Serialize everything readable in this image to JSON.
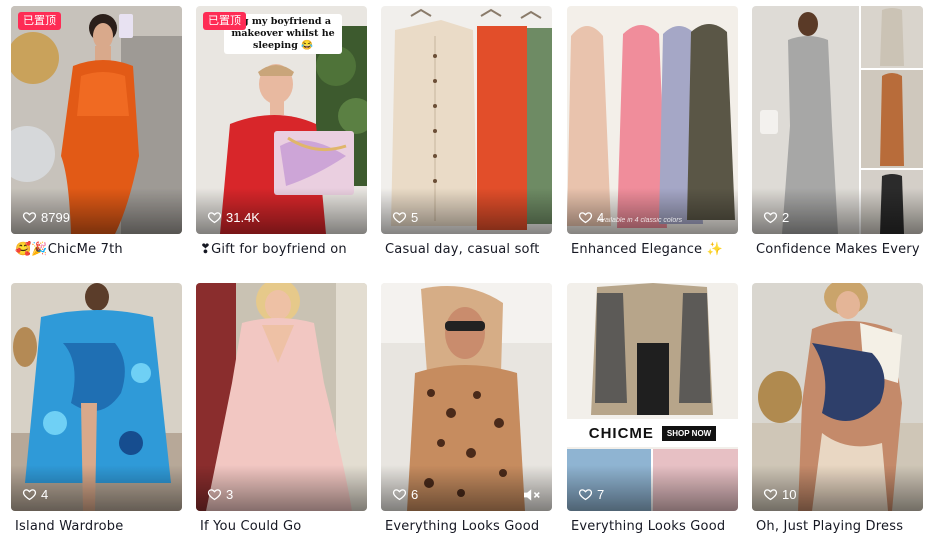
{
  "icons": {
    "like": "heart-outline-icon",
    "mute": "speaker-muted-icon"
  },
  "colors": {
    "pin_badge": "#fe2c55",
    "caption_text": "#161823"
  },
  "videos": [
    {
      "likes": "8799",
      "caption": "🥰🎉ChicMe 7th",
      "pinned": true,
      "pin_label": "已置顶",
      "overlay": ""
    },
    {
      "likes": "31.4K",
      "caption": "❣Gift for boyfriend on",
      "pinned": true,
      "pin_label": "已置顶",
      "overlay": "ng my boyfriend a makeover whilst he sleeping 😂"
    },
    {
      "likes": "5",
      "caption": "Casual day, casual soft",
      "pinned": false,
      "overlay": ""
    },
    {
      "likes": "4",
      "caption": "Enhanced Elegance ✨",
      "pinned": false,
      "overlay": "Available in 4 classic colors"
    },
    {
      "likes": "2",
      "caption": "Confidence Makes Every",
      "pinned": false,
      "overlay": ""
    },
    {
      "likes": "4",
      "caption": "Island Wardrobe",
      "pinned": false,
      "overlay": ""
    },
    {
      "likes": "3",
      "caption": "If You Could Go",
      "pinned": false,
      "overlay": ""
    },
    {
      "likes": "6",
      "caption": "Everything Looks Good",
      "pinned": false,
      "overlay": "",
      "muted": true
    },
    {
      "likes": "7",
      "caption": "Everything Looks Good",
      "pinned": false,
      "overlay": "",
      "brand": "CHICME",
      "cta": "SHOP NOW"
    },
    {
      "likes": "10",
      "caption": "Oh, Just Playing Dress",
      "pinned": false,
      "overlay": ""
    }
  ]
}
